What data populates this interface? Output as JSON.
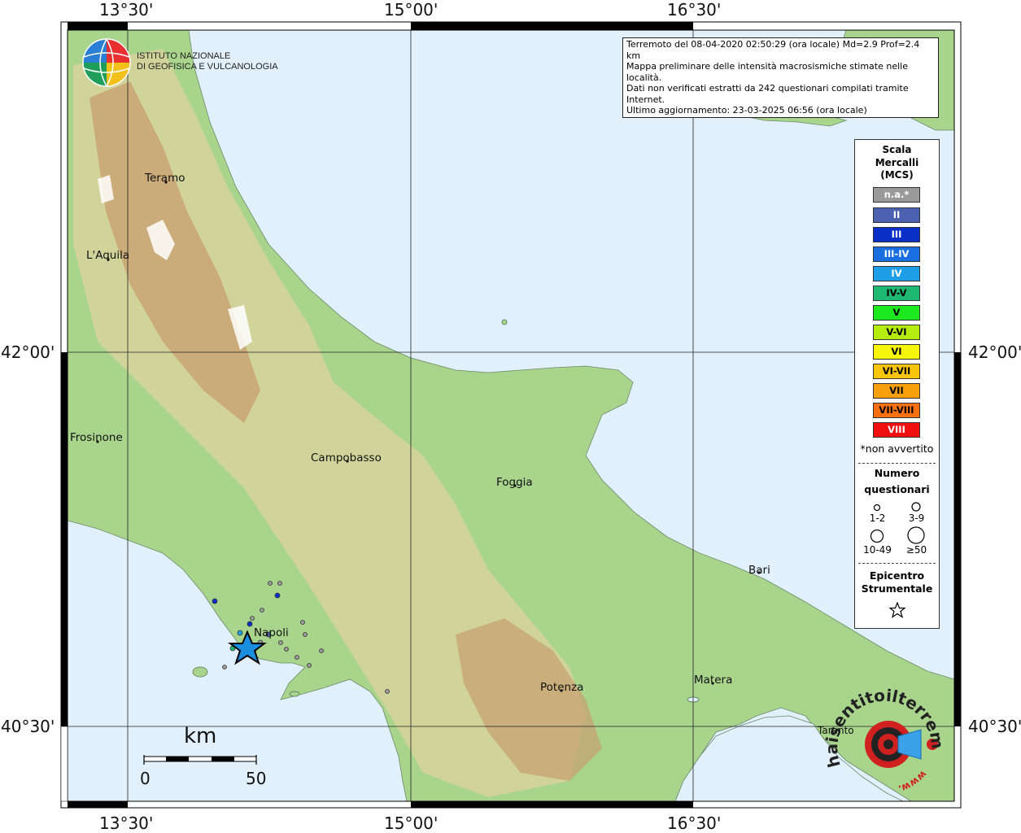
{
  "axes": {
    "lon_ticks": [
      "13°30'",
      "15°00'",
      "16°30'"
    ],
    "lat_ticks": [
      "42°00'",
      "40°30'"
    ]
  },
  "logo": {
    "line1": "ISTITUTO NAZIONALE",
    "line2": "DI GEOFISICA E VULCANOLOGIA"
  },
  "info": {
    "line1": "Terremoto del 08-04-2020 02:50:29 (ora locale) Md=2.9 Prof=2.4 km",
    "line2": "Mappa preliminare delle intensità macrosismiche stimate nelle località.",
    "line3": "Dati non verificati estratti da 242 questionari compilati tramite Internet.",
    "line4": "Ultimo aggiornamento: 23-03-2025 06:56 (ora locale)"
  },
  "cities": {
    "teramo": "Teramo",
    "laquila": "L'Aquila",
    "frosinone": "Frosinone",
    "campobasso": "Campobasso",
    "foggia": "Foggia",
    "bari": "Bari",
    "napoli": "Napoli",
    "potenza": "Potenza",
    "matera": "Matera",
    "taranto": "Taranto"
  },
  "legend": {
    "title1": "Scala",
    "title2": "Mercalli",
    "title3": "(MCS)",
    "items": [
      {
        "label": "n.a.*",
        "color": "#9a9a9a",
        "text_color": "#ffffff"
      },
      {
        "label": "II",
        "color": "#4a62b0",
        "text_color": "#ffffff"
      },
      {
        "label": "III",
        "color": "#0a2fc8",
        "text_color": "#ffffff"
      },
      {
        "label": "III-IV",
        "color": "#1a6fe0",
        "text_color": "#ffffff"
      },
      {
        "label": "IV",
        "color": "#1e9ee6",
        "text_color": "#ffffff"
      },
      {
        "label": "IV-V",
        "color": "#1fb873",
        "text_color": "#000000"
      },
      {
        "label": "V",
        "color": "#1ee81e",
        "text_color": "#000000"
      },
      {
        "label": "V-VI",
        "color": "#b4ec0e",
        "text_color": "#000000"
      },
      {
        "label": "VI",
        "color": "#f8f50c",
        "text_color": "#000000"
      },
      {
        "label": "VI-VII",
        "color": "#f8c40c",
        "text_color": "#000000"
      },
      {
        "label": "VII",
        "color": "#f8a00c",
        "text_color": "#000000"
      },
      {
        "label": "VII-VIII",
        "color": "#f87010",
        "text_color": "#000000"
      },
      {
        "label": "VIII",
        "color": "#f01010",
        "text_color": "#ffffff"
      }
    ],
    "not_felt_note": "*non avvertito",
    "count_title1": "Numero",
    "count_title2": "questionari",
    "count_labels": [
      "1-2",
      "3-9",
      "10-49",
      "≥50"
    ],
    "epicenter_title1": "Epicentro",
    "epicenter_title2": "Strumentale"
  },
  "scale": {
    "unit": "km",
    "left": "0",
    "right": "50"
  },
  "stamp": {
    "arc_text_top": "haisentitoilterremoto.it",
    "arc_text_bottom": "www."
  },
  "colors": {
    "sea": "#e2f0fb",
    "lowland": "#a8d48c",
    "hills": "#d8d49c",
    "mountains": "#c8a070",
    "peaks": "#ffffff",
    "epicenter": "#1a8fe0"
  }
}
